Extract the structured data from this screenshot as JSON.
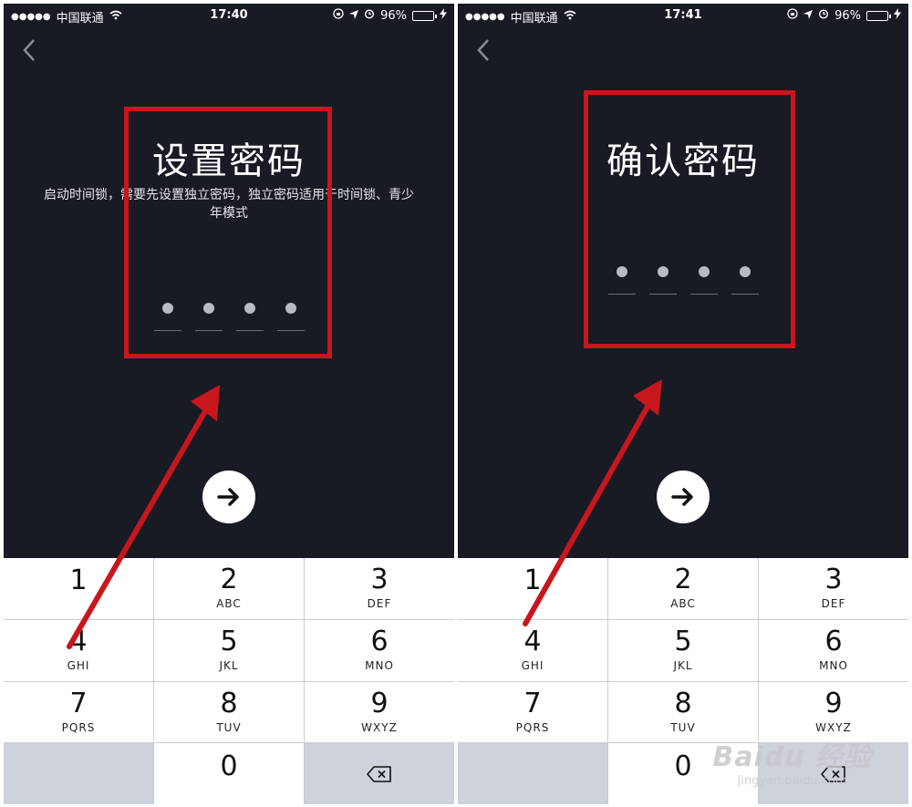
{
  "screens": [
    {
      "status": {
        "signal": "●●●●●",
        "carrier": "中国联通",
        "time": "17:40",
        "battery": "96%"
      },
      "title": "设置密码",
      "subtitle": "启动时间锁，需要先设置独立密码，独立密码适用于时间锁、青少年模式"
    },
    {
      "status": {
        "signal": "●●●●●",
        "carrier": "中国联通",
        "time": "17:41",
        "battery": "96%"
      },
      "title": "确认密码",
      "subtitle": ""
    }
  ],
  "keypad": [
    {
      "num": "1",
      "letters": ""
    },
    {
      "num": "2",
      "letters": "ABC"
    },
    {
      "num": "3",
      "letters": "DEF"
    },
    {
      "num": "4",
      "letters": "GHI"
    },
    {
      "num": "5",
      "letters": "JKL"
    },
    {
      "num": "6",
      "letters": "MNO"
    },
    {
      "num": "7",
      "letters": "PQRS"
    },
    {
      "num": "8",
      "letters": "TUV"
    },
    {
      "num": "9",
      "letters": "WXYZ"
    },
    {
      "num": "0",
      "letters": ""
    }
  ],
  "watermark": {
    "main": "Baidu 经验",
    "sub": "jingyan.baidu.com"
  },
  "colors": {
    "background": "#181a24",
    "annotation_red": "#c8161d",
    "keypad_bg": "#ffffff"
  },
  "icons": [
    "back-chevron-icon",
    "arrow-right-icon",
    "backspace-icon",
    "wifi-icon",
    "battery-icon"
  ]
}
